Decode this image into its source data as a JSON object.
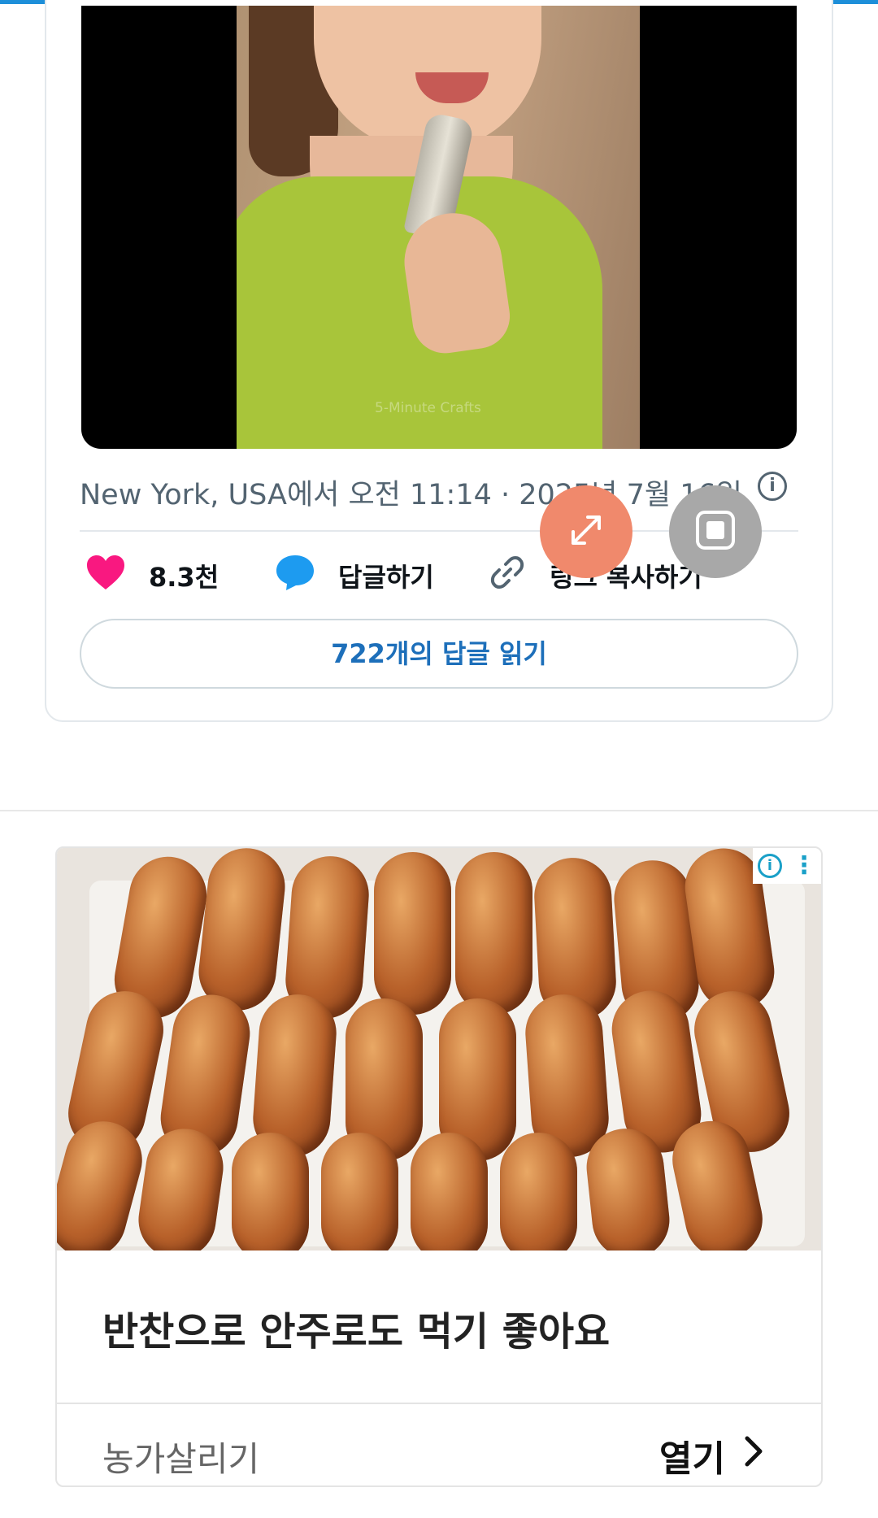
{
  "tweet": {
    "video": {
      "watermark": "5-Minute Crafts"
    },
    "meta": "New York, USA에서 오전 11:14 · 2025년 7월 16일",
    "actions": {
      "like_count": "8.3천",
      "reply_label": "답글하기",
      "copy_link_label": "링크 복사하기"
    },
    "read_replies_label": "722개의 답글 읽기"
  },
  "overlay": {
    "expand_icon": "expand-icon",
    "square_icon": "stop-square-icon"
  },
  "ad": {
    "title": "반찬으로 안주로도 먹기 좋아요",
    "advertiser": "농가살리기",
    "open_label": "열기"
  },
  "colors": {
    "accent": "#1d8fd9",
    "like": "#f91880",
    "reply": "#1d9bf0",
    "link_blue": "#1d6fba",
    "fab_orange": "#f0896c",
    "fab_gray": "#a8a8a8"
  }
}
